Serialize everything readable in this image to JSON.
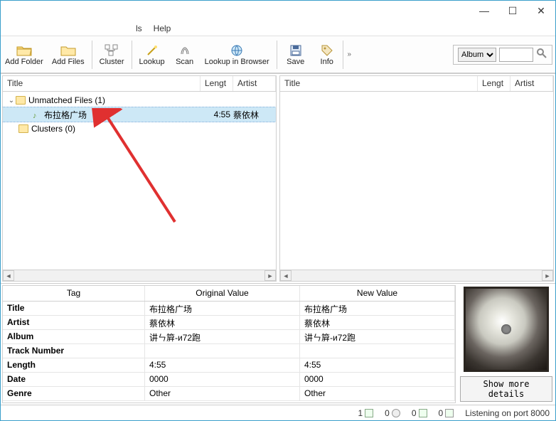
{
  "window": {
    "min": "—",
    "max": "☐",
    "close": "✕"
  },
  "menu": {
    "tools": "ls",
    "help": "Help"
  },
  "toolbar": {
    "add_folder": "Add Folder",
    "add_files": "Add Files",
    "cluster": "Cluster",
    "lookup": "Lookup",
    "scan": "Scan",
    "lookup_browser": "Lookup in Browser",
    "save": "Save",
    "info": "Info"
  },
  "search": {
    "mode": "Album",
    "placeholder": ""
  },
  "left_pane": {
    "columns": {
      "title": "Title",
      "length": "Lengt",
      "artist": "Artist"
    },
    "unmatched": {
      "label": "Unmatched Files (1)"
    },
    "track": {
      "title": "布拉格广场",
      "length": "4:55",
      "artist": "蔡依林"
    },
    "clusters": {
      "label": "Clusters (0)"
    }
  },
  "right_pane": {
    "columns": {
      "title": "Title",
      "length": "Lengt",
      "artist": "Artist"
    }
  },
  "meta": {
    "head": {
      "tag": "Tag",
      "orig": "Original Value",
      "newv": "New Value"
    },
    "rows": [
      {
        "k": "Title",
        "o": "布拉格广场",
        "n": "布拉格广场"
      },
      {
        "k": "Artist",
        "o": "蔡依林",
        "n": "蔡依林"
      },
      {
        "k": "Album",
        "o": "讲ㄣ簈-и72跑",
        "n": "讲ㄣ簈-и72跑"
      },
      {
        "k": "Track Number",
        "o": "",
        "n": ""
      },
      {
        "k": "Length",
        "o": "4:55",
        "n": "4:55"
      },
      {
        "k": "Date",
        "o": "0000",
        "n": "0000"
      },
      {
        "k": "Genre",
        "o": "Other",
        "n": "Other"
      }
    ]
  },
  "more_details": "Show more details",
  "status": {
    "c1": "1",
    "c2": "0",
    "c3": "0",
    "c4": "0",
    "port": "Listening on port 8000"
  }
}
